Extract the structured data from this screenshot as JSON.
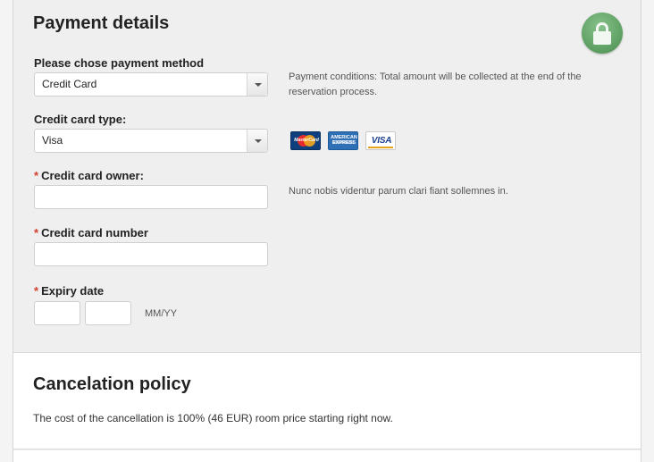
{
  "payment": {
    "title": "Payment details",
    "method_label": "Please chose payment method",
    "method_value": "Credit Card",
    "method_note": "Payment conditions: Total amount will be collected at the end of the reservation process.",
    "card_type_label": "Credit card type:",
    "card_type_value": "Visa",
    "owner_label": "Credit card owner:",
    "owner_note": "Nunc nobis videntur parum clari fiant sollemnes in.",
    "number_label": "Credit card number",
    "expiry_label": "Expiry date",
    "expiry_hint": "MM/YY",
    "required_mark": "*",
    "cards": {
      "mastercard": "MasterCard",
      "amex": "AMERICAN EXPRESS",
      "visa": "VISA"
    },
    "lock_icon": "lock-icon",
    "accent_color": "#5b9e60",
    "required_color": "#d0402e"
  },
  "cancel": {
    "title": "Cancelation policy",
    "text": "The cost of the cancellation is 100% (46 EUR) room price starting right now."
  }
}
